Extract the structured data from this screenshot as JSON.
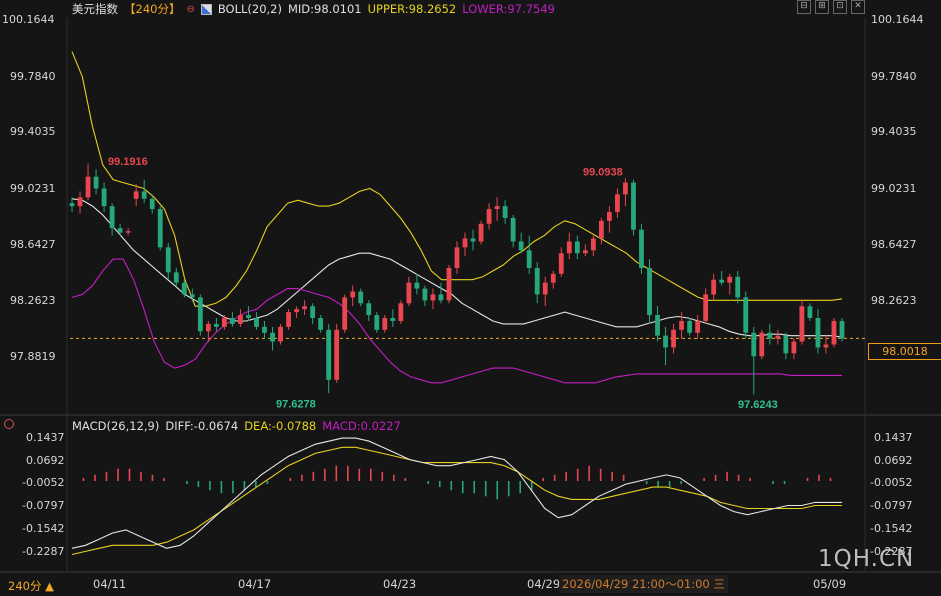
{
  "header": {
    "symbol": "美元指数",
    "period": "【240分】",
    "period_icon": "settings-icon",
    "boll_icon": "indicator-icon",
    "boll": "BOLL(20,2)",
    "mid": "MID:98.0101",
    "upper": "UPPER:98.2652",
    "lower": "LOWER:97.7549"
  },
  "macd_header": {
    "label": "MACD(26,12,9)",
    "diff": "DIFF:-0.0674",
    "dea": "DEA:-0.0788",
    "macd": "MACD:0.0227"
  },
  "window_buttons": [
    "⊟",
    "⊞",
    "⊡",
    "✕"
  ],
  "price_axis_left": [
    "100.1644",
    "99.7840",
    "99.4035",
    "99.0231",
    "98.6427",
    "98.2623",
    "97.8819"
  ],
  "price_axis_right": [
    "100.1644",
    "99.7840",
    "99.4035",
    "99.0231",
    "98.6427",
    "98.2623"
  ],
  "current_price": "98.0018",
  "macd_axis": [
    "0.1437",
    "0.0692",
    "-0.0052",
    "-0.0797",
    "-0.1542",
    "-0.2287"
  ],
  "annotations": {
    "high1": "99.1916",
    "low1": "97.6278",
    "high2": "99.0938",
    "low2": "97.6243"
  },
  "x_axis_labels": [
    "04/11",
    "04/17",
    "04/23",
    "04/29",
    "05/09"
  ],
  "footer": {
    "period": "240分 ▲",
    "crosshair_time": "2026/04/29 21:00～01:00 三"
  },
  "watermark": "1QH.CN",
  "colors": {
    "up": "#e8474f",
    "down": "#26a87a",
    "mid": "#e6e6e6",
    "upper": "#e6d21e",
    "lower": "#c41ec4",
    "accent": "#f5a623"
  },
  "chart_data": {
    "type": "candlestick",
    "title": "美元指数",
    "y_range": [
      97.5,
      100.2
    ],
    "candles": [
      [
        98.92,
        98.96,
        98.86,
        98.9
      ],
      [
        98.9,
        99.0,
        98.85,
        98.96
      ],
      [
        98.96,
        99.19,
        98.94,
        99.1
      ],
      [
        99.1,
        99.15,
        98.98,
        99.02
      ],
      [
        99.02,
        99.06,
        98.86,
        98.9
      ],
      [
        98.9,
        98.92,
        98.7,
        98.75
      ],
      [
        98.75,
        98.78,
        98.7,
        98.72
      ],
      [
        98.72,
        98.75,
        98.7,
        98.73
      ],
      [
        98.95,
        99.05,
        98.9,
        99.0
      ],
      [
        99.0,
        99.08,
        98.92,
        98.95
      ],
      [
        98.95,
        98.98,
        98.85,
        98.88
      ],
      [
        98.88,
        98.9,
        98.6,
        98.62
      ],
      [
        98.62,
        98.65,
        98.4,
        98.45
      ],
      [
        98.45,
        98.48,
        98.35,
        98.38
      ],
      [
        98.38,
        98.4,
        98.28,
        98.3
      ],
      [
        98.3,
        98.34,
        98.25,
        98.28
      ],
      [
        98.28,
        98.3,
        98.02,
        98.05
      ],
      [
        98.05,
        98.12,
        97.98,
        98.1
      ],
      [
        98.1,
        98.14,
        98.05,
        98.08
      ],
      [
        98.08,
        98.16,
        98.06,
        98.14
      ],
      [
        98.14,
        98.18,
        98.08,
        98.1
      ],
      [
        98.1,
        98.2,
        98.08,
        98.16
      ],
      [
        98.16,
        98.22,
        98.12,
        98.14
      ],
      [
        98.14,
        98.18,
        98.06,
        98.08
      ],
      [
        98.08,
        98.12,
        98.0,
        98.04
      ],
      [
        98.04,
        98.08,
        97.92,
        97.98
      ],
      [
        97.98,
        98.1,
        97.96,
        98.08
      ],
      [
        98.08,
        98.2,
        98.06,
        98.18
      ],
      [
        98.18,
        98.22,
        98.14,
        98.2
      ],
      [
        98.2,
        98.26,
        98.16,
        98.22
      ],
      [
        98.22,
        98.24,
        98.1,
        98.14
      ],
      [
        98.14,
        98.16,
        98.04,
        98.06
      ],
      [
        98.06,
        98.1,
        97.63,
        97.72
      ],
      [
        97.72,
        98.1,
        97.7,
        98.06
      ],
      [
        98.06,
        98.3,
        98.04,
        98.28
      ],
      [
        98.28,
        98.36,
        98.22,
        98.32
      ],
      [
        98.32,
        98.34,
        98.22,
        98.24
      ],
      [
        98.24,
        98.26,
        98.12,
        98.16
      ],
      [
        98.16,
        98.18,
        98.04,
        98.06
      ],
      [
        98.06,
        98.16,
        98.04,
        98.14
      ],
      [
        98.14,
        98.2,
        98.08,
        98.12
      ],
      [
        98.12,
        98.26,
        98.1,
        98.24
      ],
      [
        98.24,
        98.42,
        98.22,
        98.38
      ],
      [
        98.38,
        98.44,
        98.3,
        98.34
      ],
      [
        98.34,
        98.36,
        98.22,
        98.26
      ],
      [
        98.26,
        98.34,
        98.2,
        98.3
      ],
      [
        98.3,
        98.38,
        98.24,
        98.26
      ],
      [
        98.26,
        98.5,
        98.24,
        98.48
      ],
      [
        98.48,
        98.66,
        98.44,
        98.62
      ],
      [
        98.62,
        98.72,
        98.56,
        98.68
      ],
      [
        98.68,
        98.74,
        98.6,
        98.66
      ],
      [
        98.66,
        98.8,
        98.64,
        98.78
      ],
      [
        98.78,
        98.92,
        98.74,
        98.88
      ],
      [
        98.88,
        98.96,
        98.8,
        98.9
      ],
      [
        98.9,
        98.94,
        98.78,
        98.82
      ],
      [
        98.82,
        98.84,
        98.62,
        98.66
      ],
      [
        98.66,
        98.72,
        98.58,
        98.6
      ],
      [
        98.6,
        98.7,
        98.44,
        98.48
      ],
      [
        98.48,
        98.52,
        98.24,
        98.3
      ],
      [
        98.3,
        98.42,
        98.22,
        98.38
      ],
      [
        98.38,
        98.46,
        98.34,
        98.44
      ],
      [
        98.44,
        98.62,
        98.42,
        98.58
      ],
      [
        98.58,
        98.72,
        98.54,
        98.66
      ],
      [
        98.66,
        98.7,
        98.54,
        98.58
      ],
      [
        98.58,
        98.64,
        98.56,
        98.6
      ],
      [
        98.6,
        98.7,
        98.56,
        98.68
      ],
      [
        98.68,
        98.82,
        98.64,
        98.8
      ],
      [
        98.8,
        98.9,
        98.72,
        98.86
      ],
      [
        98.86,
        99.02,
        98.82,
        98.98
      ],
      [
        98.98,
        99.09,
        98.9,
        99.06
      ],
      [
        99.06,
        99.08,
        98.7,
        98.74
      ],
      [
        98.74,
        98.78,
        98.44,
        98.48
      ],
      [
        98.48,
        98.54,
        98.1,
        98.16
      ],
      [
        98.16,
        98.22,
        97.98,
        98.02
      ],
      [
        98.02,
        98.08,
        97.82,
        97.94
      ],
      [
        97.94,
        98.1,
        97.9,
        98.06
      ],
      [
        98.06,
        98.18,
        98.0,
        98.12
      ],
      [
        98.12,
        98.14,
        98.02,
        98.04
      ],
      [
        98.04,
        98.16,
        98.0,
        98.12
      ],
      [
        98.12,
        98.34,
        98.1,
        98.3
      ],
      [
        98.3,
        98.44,
        98.26,
        98.4
      ],
      [
        98.4,
        98.46,
        98.36,
        98.38
      ],
      [
        98.38,
        98.44,
        98.3,
        98.42
      ],
      [
        98.42,
        98.46,
        98.24,
        98.28
      ],
      [
        98.28,
        98.32,
        98.0,
        98.04
      ],
      [
        98.04,
        98.08,
        97.62,
        97.88
      ],
      [
        97.88,
        98.06,
        97.86,
        98.04
      ],
      [
        98.04,
        98.1,
        97.96,
        98.0
      ],
      [
        98.0,
        98.06,
        97.96,
        98.02
      ],
      [
        98.02,
        98.04,
        97.86,
        97.9
      ],
      [
        97.9,
        98.0,
        97.86,
        97.98
      ],
      [
        97.98,
        98.26,
        97.96,
        98.22
      ],
      [
        98.22,
        98.24,
        98.12,
        98.14
      ],
      [
        98.14,
        98.2,
        97.9,
        97.94
      ],
      [
        97.94,
        98.02,
        97.9,
        97.96
      ],
      [
        97.96,
        98.14,
        97.94,
        98.12
      ],
      [
        98.12,
        98.14,
        97.98,
        98.0
      ]
    ],
    "mid": [
      98.95,
      98.94,
      98.9,
      98.84,
      98.76,
      98.68,
      98.6,
      98.54,
      98.48,
      98.42,
      98.36,
      98.3,
      98.26,
      98.22,
      98.18,
      98.14,
      98.12,
      98.12,
      98.14,
      98.16,
      98.2,
      98.26,
      98.32,
      98.38,
      98.44,
      98.5,
      98.54,
      98.56,
      98.58,
      98.58,
      98.56,
      98.54,
      98.5,
      98.46,
      98.42,
      98.38,
      98.34,
      98.3,
      98.24,
      98.2,
      98.16,
      98.12,
      98.1,
      98.1,
      98.1,
      98.12,
      98.14,
      98.16,
      98.18,
      98.16,
      98.14,
      98.12,
      98.1,
      98.08,
      98.08,
      98.08,
      98.1,
      98.12,
      98.14,
      98.15,
      98.14,
      98.12,
      98.1,
      98.08,
      98.05,
      98.03,
      98.02,
      98.02,
      98.03,
      98.03,
      98.02,
      98.02,
      98.02,
      98.02,
      98.02,
      98.01
    ],
    "upper": [
      99.95,
      99.78,
      99.44,
      99.18,
      99.08,
      99.06,
      99.04,
      99.02,
      98.96,
      98.88,
      98.7,
      98.4,
      98.22,
      98.22,
      98.24,
      98.28,
      98.36,
      98.46,
      98.6,
      98.76,
      98.84,
      98.92,
      98.94,
      98.92,
      98.9,
      98.9,
      98.92,
      98.96,
      99.0,
      99.02,
      98.98,
      98.9,
      98.82,
      98.72,
      98.6,
      98.46,
      98.4,
      98.4,
      98.4,
      98.4,
      98.42,
      98.46,
      98.5,
      98.56,
      98.6,
      98.66,
      98.7,
      98.76,
      98.8,
      98.78,
      98.74,
      98.7,
      98.66,
      98.62,
      98.58,
      98.52,
      98.48,
      98.44,
      98.4,
      98.36,
      98.32,
      98.28,
      98.26,
      98.26,
      98.26,
      98.26,
      98.26,
      98.26,
      98.26,
      98.26,
      98.26,
      98.26,
      98.26,
      98.26,
      98.26,
      98.27
    ],
    "lower": [
      98.28,
      98.3,
      98.36,
      98.46,
      98.54,
      98.54,
      98.4,
      98.2,
      97.98,
      97.84,
      97.8,
      97.82,
      97.86,
      97.96,
      98.04,
      98.1,
      98.14,
      98.18,
      98.2,
      98.26,
      98.3,
      98.34,
      98.34,
      98.32,
      98.3,
      98.28,
      98.24,
      98.18,
      98.1,
      98.0,
      97.92,
      97.84,
      97.78,
      97.74,
      97.72,
      97.7,
      97.7,
      97.72,
      97.74,
      97.76,
      97.78,
      97.8,
      97.8,
      97.8,
      97.78,
      97.76,
      97.74,
      97.72,
      97.7,
      97.7,
      97.7,
      97.7,
      97.72,
      97.74,
      97.75,
      97.76,
      97.76,
      97.76,
      97.76,
      97.76,
      97.76,
      97.76,
      97.76,
      97.76,
      97.76,
      97.76,
      97.76,
      97.76,
      97.76,
      97.76,
      97.75,
      97.75,
      97.75,
      97.75,
      97.75,
      97.75
    ],
    "current": 98.0018,
    "macd": {
      "y_range": [
        -0.26,
        0.16
      ],
      "hist": [
        0.0,
        0.01,
        0.02,
        0.03,
        0.04,
        0.04,
        0.03,
        0.02,
        0.01,
        0.0,
        -0.01,
        -0.02,
        -0.03,
        -0.04,
        -0.04,
        -0.03,
        -0.02,
        -0.01,
        0.0,
        0.01,
        0.02,
        0.03,
        0.04,
        0.05,
        0.05,
        0.04,
        0.04,
        0.03,
        0.02,
        0.01,
        0.0,
        -0.01,
        -0.02,
        -0.03,
        -0.04,
        -0.04,
        -0.05,
        -0.06,
        -0.05,
        -0.04,
        -0.03,
        0.01,
        0.02,
        0.03,
        0.04,
        0.05,
        0.04,
        0.03,
        0.02,
        0.0,
        -0.01,
        -0.02,
        -0.02,
        -0.01,
        0.0,
        0.01,
        0.02,
        0.03,
        0.02,
        0.01,
        0.0,
        -0.01,
        -0.01,
        0.0,
        0.01,
        0.02,
        0.01,
        0.0
      ],
      "diff": [
        -0.22,
        -0.21,
        -0.19,
        -0.17,
        -0.16,
        -0.18,
        -0.2,
        -0.22,
        -0.21,
        -0.18,
        -0.14,
        -0.1,
        -0.06,
        -0.02,
        0.02,
        0.05,
        0.08,
        0.1,
        0.12,
        0.13,
        0.14,
        0.14,
        0.13,
        0.11,
        0.09,
        0.07,
        0.06,
        0.05,
        0.05,
        0.06,
        0.07,
        0.08,
        0.07,
        0.03,
        -0.03,
        -0.09,
        -0.12,
        -0.11,
        -0.08,
        -0.05,
        -0.03,
        -0.01,
        0.0,
        0.01,
        0.02,
        0.01,
        -0.02,
        -0.05,
        -0.08,
        -0.1,
        -0.11,
        -0.1,
        -0.09,
        -0.08,
        -0.08,
        -0.07,
        -0.07,
        -0.07
      ],
      "dea": [
        -0.24,
        -0.23,
        -0.22,
        -0.21,
        -0.21,
        -0.21,
        -0.21,
        -0.2,
        -0.18,
        -0.16,
        -0.13,
        -0.1,
        -0.07,
        -0.04,
        -0.01,
        0.02,
        0.05,
        0.07,
        0.09,
        0.1,
        0.11,
        0.11,
        0.1,
        0.09,
        0.08,
        0.07,
        0.06,
        0.06,
        0.06,
        0.06,
        0.06,
        0.06,
        0.05,
        0.03,
        0.0,
        -0.03,
        -0.05,
        -0.06,
        -0.06,
        -0.06,
        -0.05,
        -0.04,
        -0.03,
        -0.02,
        -0.02,
        -0.03,
        -0.04,
        -0.05,
        -0.07,
        -0.08,
        -0.09,
        -0.09,
        -0.09,
        -0.09,
        -0.09,
        -0.08,
        -0.08,
        -0.08
      ]
    }
  }
}
